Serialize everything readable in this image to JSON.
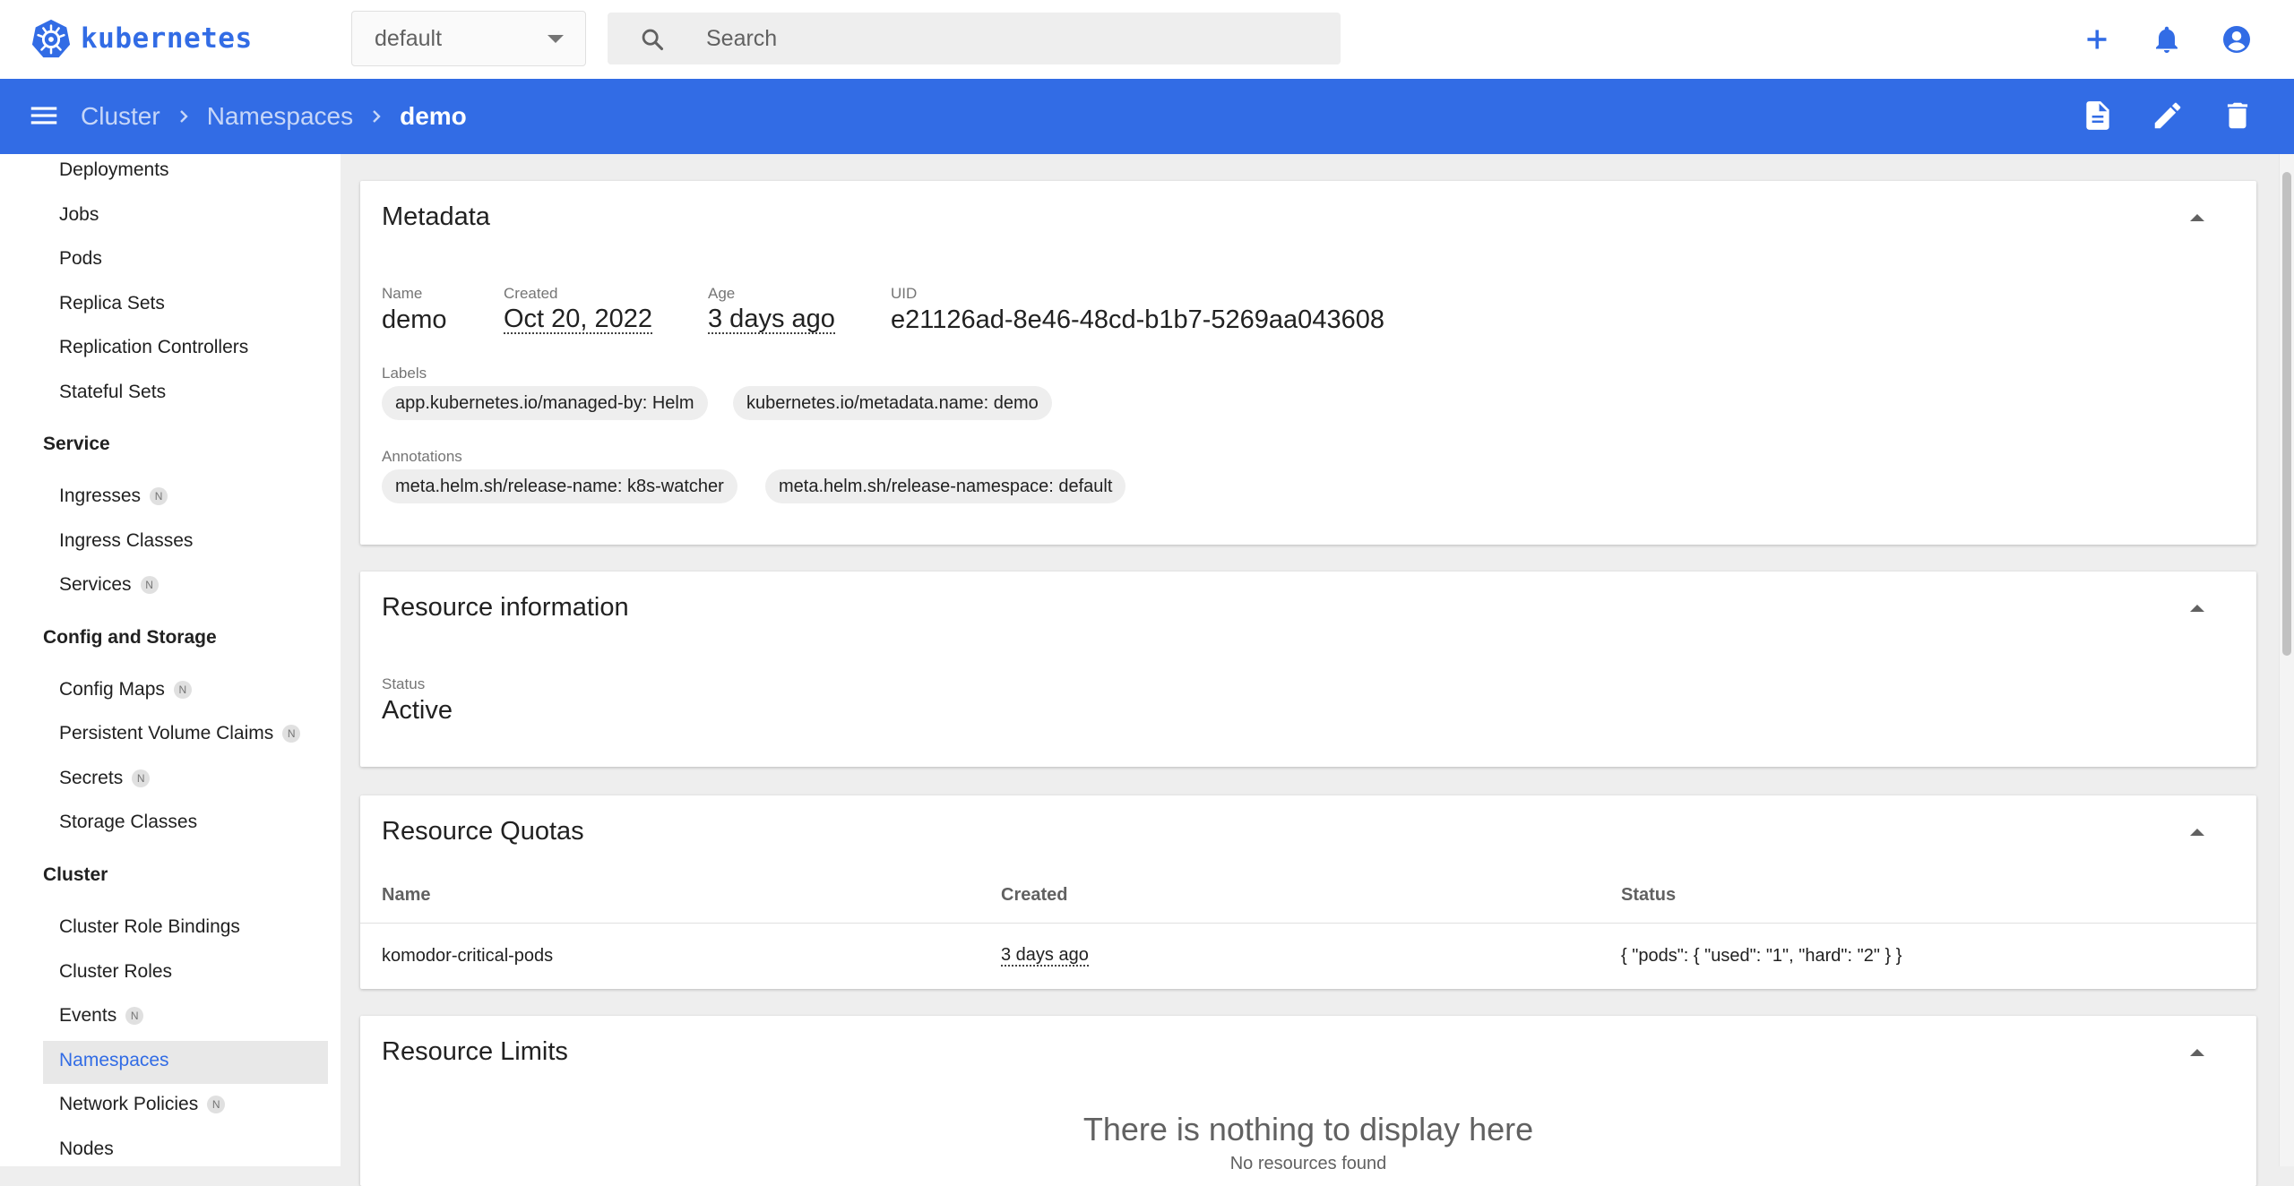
{
  "app": {
    "name": "kubernetes"
  },
  "topbar": {
    "namespace_selected": "default",
    "search_placeholder": "Search"
  },
  "breadcrumb": {
    "items": [
      "Cluster",
      "Namespaces"
    ],
    "current": "demo"
  },
  "sidebar": {
    "workloads": [
      "Deployments",
      "Jobs",
      "Pods",
      "Replica Sets",
      "Replication Controllers",
      "Stateful Sets"
    ],
    "service_header": "Service",
    "service": [
      {
        "label": "Ingresses",
        "badge": "N"
      },
      {
        "label": "Ingress Classes",
        "badge": ""
      },
      {
        "label": "Services",
        "badge": "N"
      }
    ],
    "config_header": "Config and Storage",
    "config": [
      {
        "label": "Config Maps",
        "badge": "N"
      },
      {
        "label": "Persistent Volume Claims",
        "badge": "N"
      },
      {
        "label": "Secrets",
        "badge": "N"
      },
      {
        "label": "Storage Classes",
        "badge": ""
      }
    ],
    "cluster_header": "Cluster",
    "cluster": [
      {
        "label": "Cluster Role Bindings",
        "badge": ""
      },
      {
        "label": "Cluster Roles",
        "badge": ""
      },
      {
        "label": "Events",
        "badge": "N"
      },
      {
        "label": "Namespaces",
        "badge": "",
        "active": true
      },
      {
        "label": "Network Policies",
        "badge": "N"
      },
      {
        "label": "Nodes",
        "badge": ""
      }
    ]
  },
  "metadata": {
    "title": "Metadata",
    "name_label": "Name",
    "name": "demo",
    "created_label": "Created",
    "created": "Oct 20, 2022",
    "age_label": "Age",
    "age": "3 days ago",
    "uid_label": "UID",
    "uid": "e21126ad-8e46-48cd-b1b7-5269aa043608",
    "labels_label": "Labels",
    "labels": [
      "app.kubernetes.io/managed-by: Helm",
      "kubernetes.io/metadata.name: demo"
    ],
    "annotations_label": "Annotations",
    "annotations": [
      "meta.helm.sh/release-name: k8s-watcher",
      "meta.helm.sh/release-namespace: default"
    ]
  },
  "resource_info": {
    "title": "Resource information",
    "status_label": "Status",
    "status": "Active"
  },
  "quotas": {
    "title": "Resource Quotas",
    "columns": [
      "Name",
      "Created",
      "Status"
    ],
    "rows": [
      {
        "name": "komodor-critical-pods",
        "created": "3 days ago",
        "status": "{ \"pods\": { \"used\": \"1\", \"hard\": \"2\" } }"
      }
    ]
  },
  "limits": {
    "title": "Resource Limits",
    "empty_title": "There is nothing to display here",
    "empty_sub": "No resources found"
  },
  "colors": {
    "primary": "#326ce5",
    "background": "#eeeeee"
  }
}
